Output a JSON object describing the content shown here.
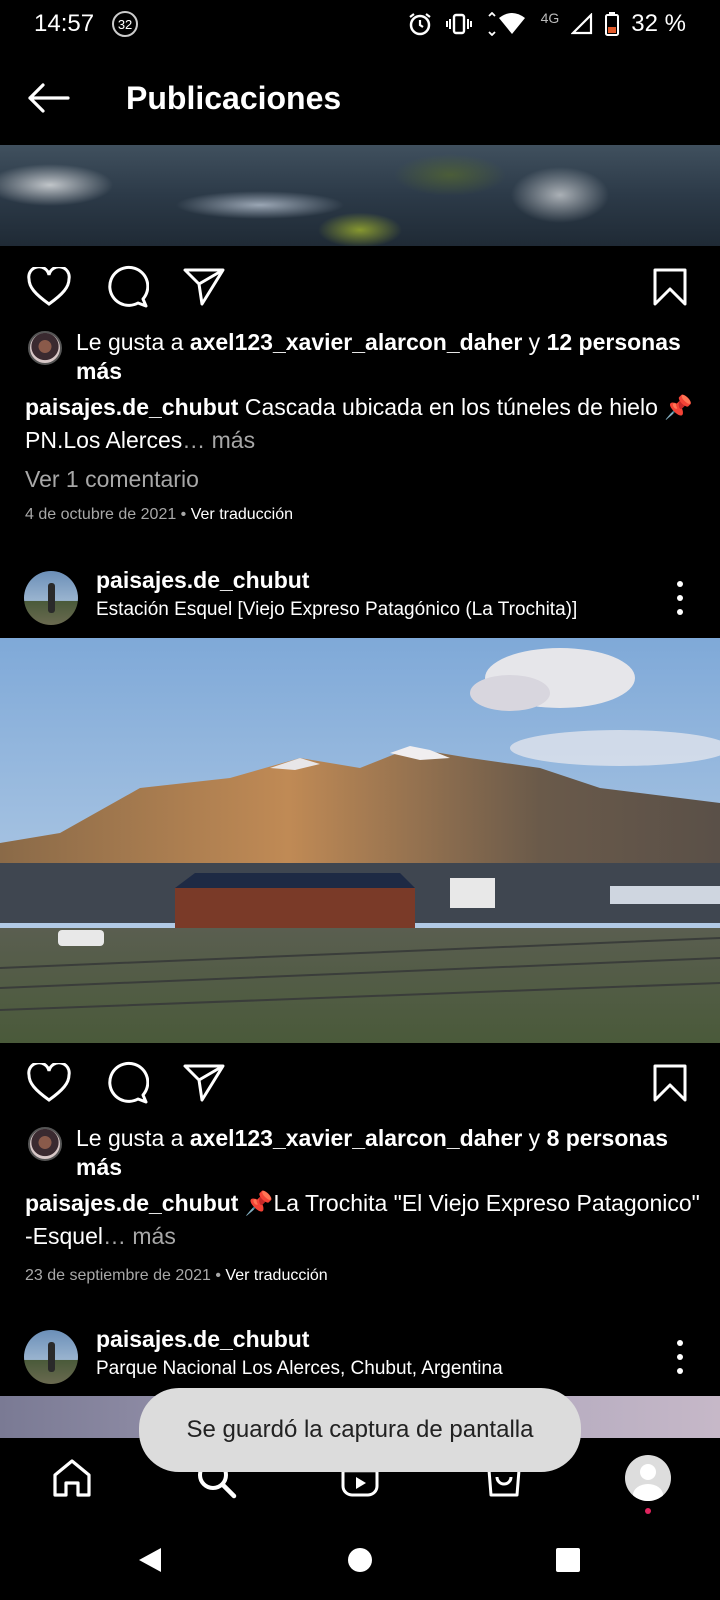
{
  "status_bar": {
    "time": "14:57",
    "notification_count": "32",
    "network": "4G",
    "battery": "32 %"
  },
  "header": {
    "title": "Publicaciones"
  },
  "post1": {
    "likes_prefix": "Le gusta a ",
    "liker": "axel123_xavier_alarcon_daher",
    "likes_mid": " y ",
    "likes_others": "12 personas más",
    "caption_user": "paisajes.de_chubut",
    "caption_text": " Cascada ubicada en los túneles de hielo 📌PN.Los Alerces",
    "caption_more": "… más",
    "comments_link": "Ver 1 comentario",
    "date": "4 de octubre de 2021",
    "separator": " • ",
    "translate": "Ver traducción"
  },
  "post2": {
    "username": "paisajes.de_chubut",
    "location": "Estación Esquel [Viejo Expreso Patagónico (La Trochita)]",
    "likes_prefix": "Le gusta a ",
    "liker": "axel123_xavier_alarcon_daher",
    "likes_mid": " y ",
    "likes_others": "8 personas más",
    "caption_user": "paisajes.de_chubut",
    "caption_text": " 📌La Trochita \"El Viejo Expreso Patagonico\" -Esquel",
    "caption_more": "… más",
    "date": "23 de septiembre de 2021",
    "separator": " • ",
    "translate": "Ver traducción"
  },
  "post3": {
    "username": "paisajes.de_chubut",
    "location": "Parque Nacional Los Alerces, Chubut, Argentina"
  },
  "toast": {
    "message": "Se guardó la captura de pantalla"
  },
  "colors": {
    "background": "#000000",
    "muted_text": "#a8a8a8",
    "toast_bg": "#dcdcdc",
    "notification_dot": "#e0245e"
  }
}
